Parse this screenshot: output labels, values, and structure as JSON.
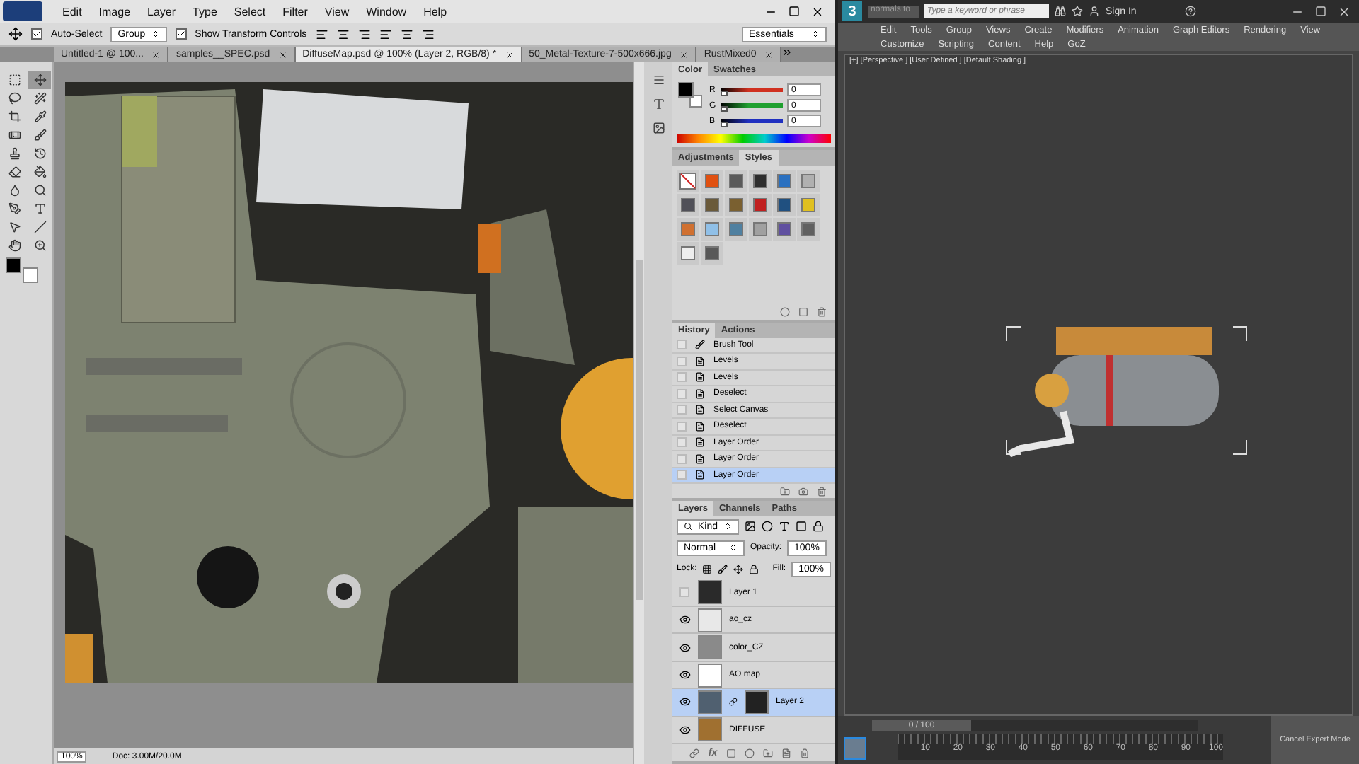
{
  "photoshop": {
    "menu": [
      "Edit",
      "Image",
      "Layer",
      "Type",
      "Select",
      "Filter",
      "View",
      "Window",
      "Help"
    ],
    "options": {
      "auto_select": {
        "label": "Auto-Select",
        "checked": true
      },
      "target": "Group",
      "transform": {
        "label": "Show Transform Controls",
        "checked": true
      },
      "workspace": "Essentials"
    },
    "documents": [
      {
        "label": "Untitled-1 @ 100...",
        "selected": false
      },
      {
        "label": "samples__SPEC.psd",
        "selected": false
      },
      {
        "label": "DiffuseMap.psd @ 100% (Layer 2, RGB/8) *",
        "selected": true
      },
      {
        "label": "50_Metal-Texture-7-500x666.jpg",
        "selected": false
      },
      {
        "label": "RustMixed0",
        "selected": false
      }
    ],
    "tools": [
      {
        "kind": "marquee",
        "selected": false
      },
      {
        "kind": "move",
        "selected": true
      },
      {
        "kind": "lasso",
        "selected": false
      },
      {
        "kind": "wand",
        "selected": false
      },
      {
        "kind": "crop",
        "selected": false
      },
      {
        "kind": "eyedropper",
        "selected": false
      },
      {
        "kind": "heal",
        "selected": false
      },
      {
        "kind": "brush",
        "selected": false
      },
      {
        "kind": "stamp",
        "selected": false
      },
      {
        "kind": "history",
        "selected": false
      },
      {
        "kind": "eraser",
        "selected": false
      },
      {
        "kind": "bucket",
        "selected": false
      },
      {
        "kind": "blur",
        "selected": false
      },
      {
        "kind": "dodge",
        "selected": false
      },
      {
        "kind": "pen",
        "selected": false
      },
      {
        "kind": "type",
        "selected": false
      },
      {
        "kind": "path",
        "selected": false
      },
      {
        "kind": "line",
        "selected": false
      },
      {
        "kind": "hand",
        "selected": false
      },
      {
        "kind": "zoom",
        "selected": false
      }
    ],
    "status": {
      "zoom": "100%",
      "doc": "Doc: 3.00M/20.0M"
    },
    "color_panel": {
      "tabs": [
        {
          "label": "Color",
          "selected": true
        },
        {
          "label": "Swatches",
          "selected": false
        }
      ],
      "channels": [
        {
          "name": "R",
          "value": "0",
          "level": 0,
          "color": "#d03020"
        },
        {
          "name": "G",
          "value": "0",
          "level": 0,
          "color": "#20a030"
        },
        {
          "name": "B",
          "value": "0",
          "level": 0,
          "color": "#2030c0"
        }
      ]
    },
    "styles_panel": {
      "tabs": [
        {
          "label": "Adjustments",
          "selected": false
        },
        {
          "label": "Styles",
          "selected": true
        }
      ],
      "styles": [
        {
          "kind": "none",
          "color": "#ffffff"
        },
        {
          "kind": "swatch",
          "color": "#e05010"
        },
        {
          "kind": "swatch",
          "color": "#5a5a5a"
        },
        {
          "kind": "swatch",
          "color": "#2e2e2e"
        },
        {
          "kind": "swatch",
          "color": "#2a70c0"
        },
        {
          "kind": "swatch",
          "color": "#b0b0b0"
        },
        {
          "kind": "swatch",
          "color": "#505058"
        },
        {
          "kind": "swatch",
          "color": "#6a5a3a"
        },
        {
          "kind": "swatch",
          "color": "#7a6030"
        },
        {
          "kind": "swatch",
          "color": "#c02020"
        },
        {
          "kind": "swatch",
          "color": "#205080"
        },
        {
          "kind": "swatch",
          "color": "#e0c020"
        },
        {
          "kind": "swatch",
          "color": "#d07030"
        },
        {
          "kind": "swatch",
          "color": "#90c0e8"
        },
        {
          "kind": "swatch",
          "color": "#5080a0"
        },
        {
          "kind": "swatch",
          "color": "#a0a0a0"
        },
        {
          "kind": "swatch",
          "color": "#6050a0"
        },
        {
          "kind": "swatch",
          "color": "#606060"
        },
        {
          "kind": "swatch",
          "color": "#eeeeee"
        },
        {
          "kind": "swatch",
          "color": "#585858"
        }
      ]
    },
    "history_panel": {
      "tabs": [
        {
          "label": "History",
          "selected": true
        },
        {
          "label": "Actions",
          "selected": false
        }
      ],
      "items": [
        {
          "label": "Brush Tool",
          "kind": "brush",
          "selected": false
        },
        {
          "label": "Levels",
          "kind": "step",
          "selected": false
        },
        {
          "label": "Levels",
          "kind": "step",
          "selected": false
        },
        {
          "label": "Deselect",
          "kind": "step",
          "selected": false
        },
        {
          "label": "Select Canvas",
          "kind": "step",
          "selected": false
        },
        {
          "label": "Deselect",
          "kind": "step",
          "selected": false
        },
        {
          "label": "Layer Order",
          "kind": "step",
          "selected": false
        },
        {
          "label": "Layer Order",
          "kind": "step",
          "selected": false
        },
        {
          "label": "Layer Order",
          "kind": "step",
          "selected": true
        }
      ]
    },
    "layers_panel": {
      "tabs": [
        {
          "label": "Layers",
          "selected": true
        },
        {
          "label": "Channels",
          "selected": false
        },
        {
          "label": "Paths",
          "selected": false
        }
      ],
      "filter": "Kind",
      "blend_mode": "Normal",
      "opacity_label": "Opacity:",
      "opacity": "100%",
      "lock_label": "Lock:",
      "fill_label": "Fill:",
      "fill": "100%",
      "layers": [
        {
          "name": "Layer 1",
          "visible": false,
          "selected": false,
          "masked": false,
          "color": "#2a2a2a"
        },
        {
          "name": "ao_cz",
          "visible": true,
          "selected": false,
          "masked": false,
          "color": "#e8e8e8"
        },
        {
          "name": "color_CZ",
          "visible": true,
          "selected": false,
          "masked": false,
          "color": "#8a8a8a"
        },
        {
          "name": "AO map",
          "visible": true,
          "selected": false,
          "masked": false,
          "color": "#ffffff"
        },
        {
          "name": "Layer 2",
          "visible": true,
          "selected": true,
          "masked": true,
          "color": "#506070"
        },
        {
          "name": "DIFFUSE",
          "visible": true,
          "selected": false,
          "masked": false,
          "color": "#a07030"
        }
      ],
      "fx": "fx"
    }
  },
  "max": {
    "logo": "3",
    "quick_field": "normals to",
    "search": {
      "placeholder": "Type a keyword or phrase"
    },
    "sign_in": "Sign In",
    "menu_rows": [
      [
        "Edit",
        "Tools",
        "Group",
        "Views",
        "Create",
        "Modifiers",
        "Animation",
        "Graph Editors",
        "Rendering",
        "View"
      ],
      [
        "Customize",
        "Scripting",
        "Content",
        "Help",
        "GoZ"
      ]
    ],
    "viewport_label": "[+] [Perspective ] [User Defined ] [Default Shading ]",
    "timeline": {
      "position": "0 / 100",
      "level": 0,
      "ticks": [
        "10",
        "20",
        "30",
        "40",
        "50",
        "60",
        "70",
        "80",
        "90",
        "100"
      ]
    },
    "expert_button": "Cancel Expert Mode"
  }
}
